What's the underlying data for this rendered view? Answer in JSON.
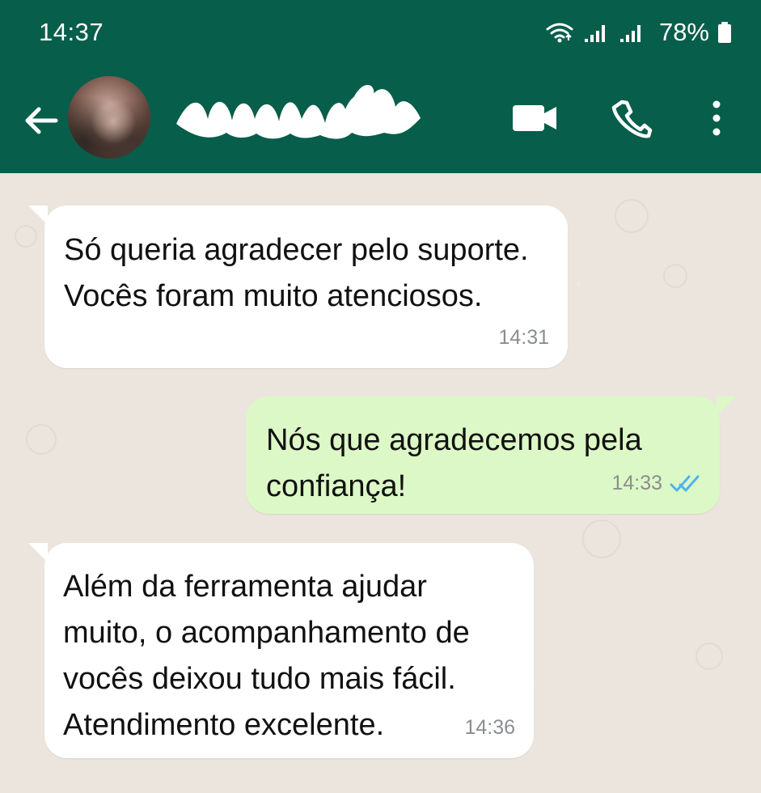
{
  "status_bar": {
    "time": "14:37",
    "battery_percent": "78%",
    "icons": [
      "wifi-icon",
      "signal-icon",
      "signal-icon",
      "battery-icon"
    ]
  },
  "header": {
    "icons": [
      "arrow-left-icon",
      "avatar",
      "video-call-icon",
      "phone-icon",
      "more-vertical-icon"
    ],
    "contact_name_redacted": true
  },
  "messages": [
    {
      "direction": "incoming",
      "text": "Só queria agradecer pelo suporte. Vocês foram muito atenciosos.",
      "time": "14:31"
    },
    {
      "direction": "outgoing",
      "text": "Nós que agradecemos pela confiança!",
      "time": "14:33",
      "status": "read"
    },
    {
      "direction": "incoming",
      "text": "Além da ferramenta ajudar muito, o acompanhamento de vocês deixou tudo mais fácil. Atendimento excelente.",
      "time": "14:36"
    }
  ],
  "colors": {
    "header_green": "#075e4b",
    "chat_background": "#ece5dd",
    "incoming_bubble": "#ffffff",
    "outgoing_bubble": "#dcf8c6",
    "read_tick": "#4fb3f0"
  }
}
